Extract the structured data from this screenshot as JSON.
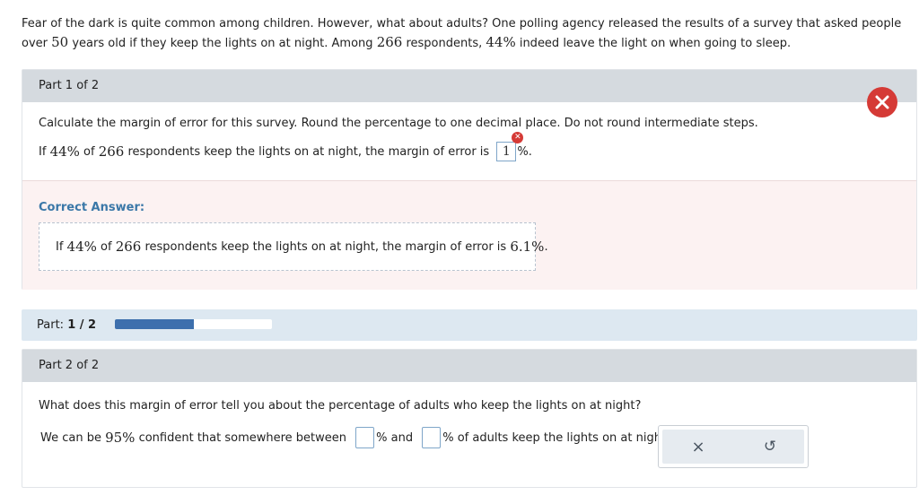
{
  "intro": {
    "t1": "Fear of the dark is quite common among children. However, what about adults? One polling agency released the results of a survey that asked people over ",
    "age": "50",
    "t2": " years old if they keep the lights on at night. Among ",
    "n": "266",
    "t3": " respondents, ",
    "pct": "44%",
    "t4": " indeed leave the light on when going to sleep."
  },
  "part1": {
    "header": "Part 1 of 2",
    "question": "Calculate the margin of error for this survey. Round the percentage to one decimal place. Do not round intermediate steps.",
    "stmt_if": "If ",
    "stmt_pct": "44%",
    "stmt_of": " of ",
    "stmt_n": "266",
    "stmt_rest": " respondents keep the lights on at night, the margin of error is ",
    "entered_value": "1",
    "stmt_unit": "%.",
    "wrong_icon": "x-mark-icon",
    "status": "incorrect",
    "correct_label": "Correct Answer:",
    "correct_if": "If ",
    "correct_pct": "44%",
    "correct_of": " of ",
    "correct_n": "266",
    "correct_rest": " respondents keep the lights on at night, the margin of error is ",
    "correct_value": "6.1%",
    "correct_end": "."
  },
  "progress": {
    "label": "Part: ",
    "current": "1",
    "sep": " / ",
    "total": "2",
    "fraction": 0.5,
    "color": "#3d6fad"
  },
  "part2": {
    "header": "Part 2 of 2",
    "question": "What does this margin of error tell you about the percentage of adults who keep the lights on at night?",
    "s1": "We can be ",
    "conf": "95%",
    "s2": " confident that somewhere between ",
    "s3": "% and ",
    "s4": "% of adults keep the lights on at night.",
    "blank1": "",
    "blank2": ""
  },
  "tools": {
    "clear": "×",
    "undo": "↺"
  },
  "colors": {
    "error": "#d53a36",
    "accent": "#3b78a8"
  }
}
